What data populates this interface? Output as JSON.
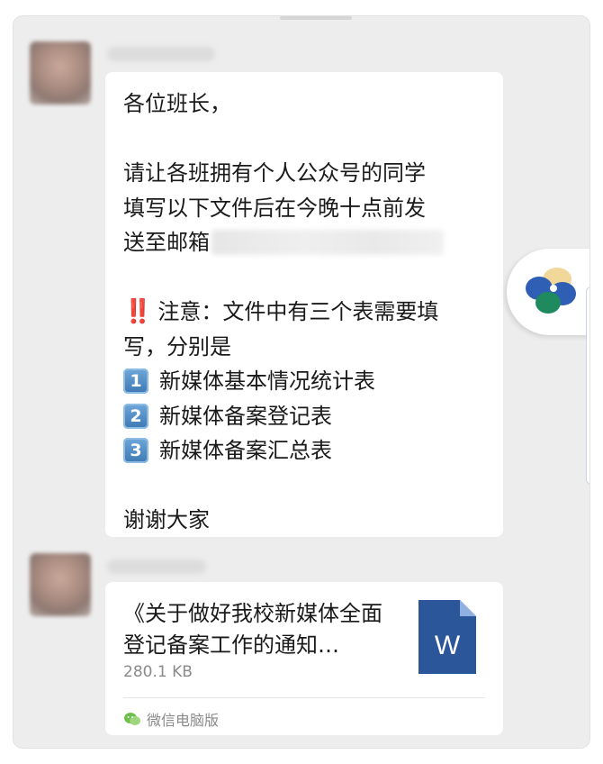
{
  "messages": [
    {
      "lines": [
        "各位班长，",
        "",
        "请让各班拥有个人公众号的同学",
        "填写以下文件后在今晚十点前发",
        "送至邮箱",
        "",
        "注意：文件中有三个表需要填",
        "写，分别是",
        "新媒体基本情况统计表",
        "新媒体备案登记表",
        "新媒体备案汇总表",
        "",
        "谢谢大家"
      ],
      "alarm_icon": "‼️",
      "keycaps": [
        "1",
        "2",
        "3"
      ]
    },
    {
      "file": {
        "title": "《关于做好我校新媒体全面登记备案工作的通知…",
        "size": "280.1 KB",
        "icon_letter": "W",
        "icon_color": "#2b579a",
        "source": "微信电脑版"
      }
    }
  ],
  "icons": {
    "file": "word-document-icon",
    "source": "wechat-icon",
    "side": "app-logo-icon"
  }
}
